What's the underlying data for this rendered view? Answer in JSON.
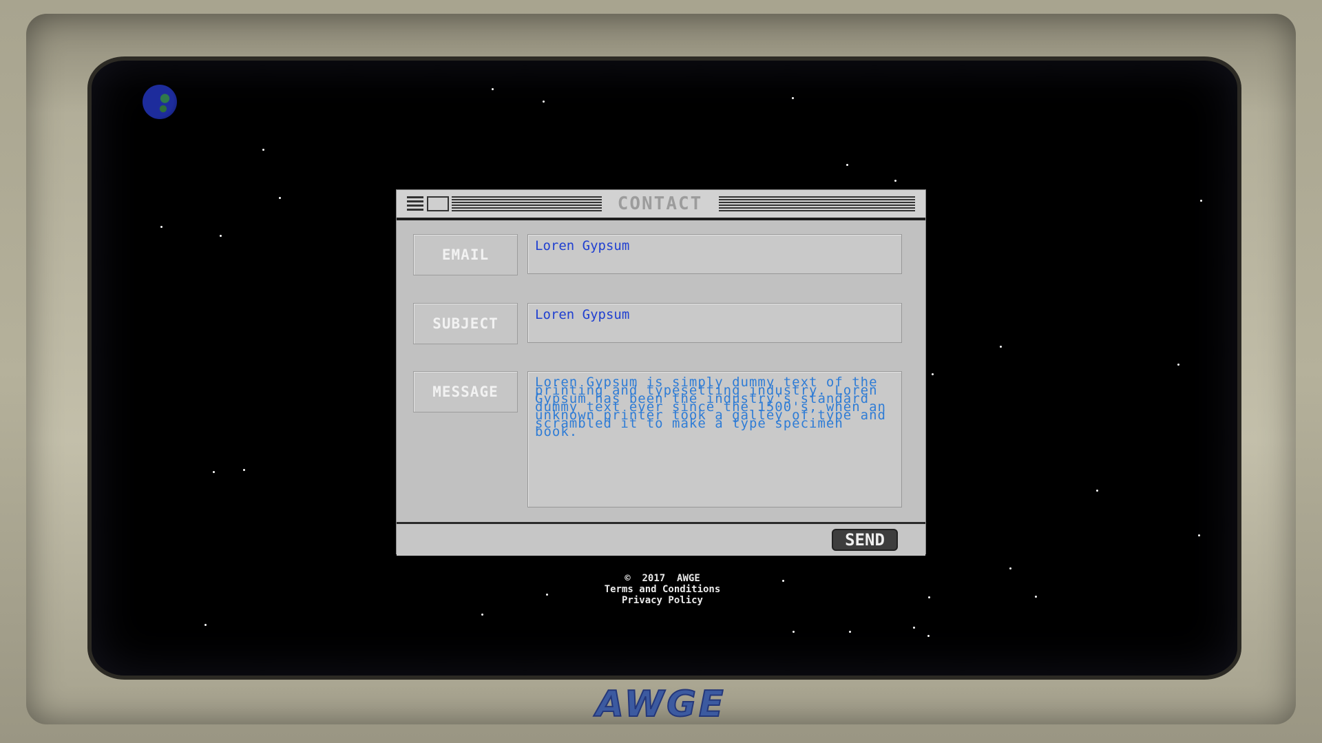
{
  "window": {
    "title": "CONTACT"
  },
  "form": {
    "email": {
      "label": "EMAIL",
      "value": "Loren Gypsum"
    },
    "subject": {
      "label": "SUBJECT",
      "value": "Loren Gypsum"
    },
    "message": {
      "label": "MESSAGE",
      "value": "Loren Gypsum is simply dummy text of the printing and typesetting industry. Loren Gypsum has been the industry's standard dummy text ever since the 1500's, when an unknown printer took a galley of type and scrambled it to make a type specimen book."
    },
    "send_label": "SEND"
  },
  "footer": {
    "copyright": "©  2017  AWGE",
    "terms": "Terms and Conditions",
    "privacy": "Privacy Policy"
  },
  "brand": {
    "logo_text": "AWGE"
  },
  "colors": {
    "input_text": "#1f3fd0",
    "message_text": "#2e7cd6",
    "logo": "#3c5aa0"
  },
  "icons": {
    "earth": "earth-icon",
    "menu": "window-menu-icon",
    "box": "window-box-icon"
  }
}
